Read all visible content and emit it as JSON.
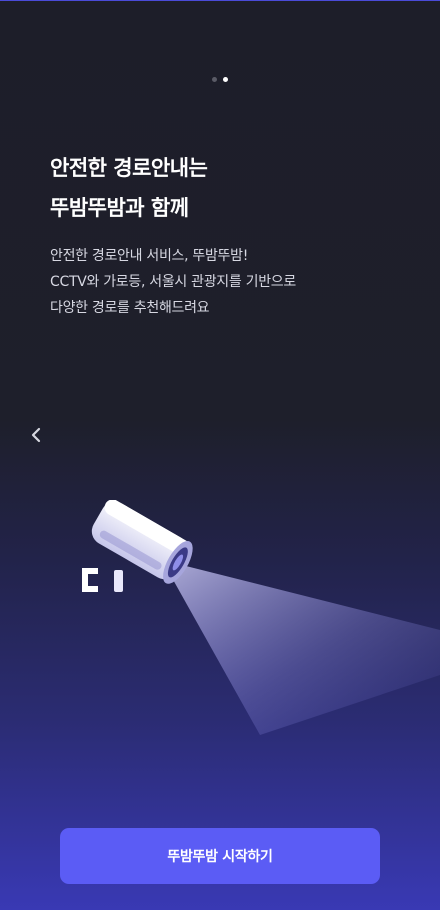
{
  "pager": {
    "total": 2,
    "active_index": 1
  },
  "headline": {
    "line1": "안전한 경로안내는",
    "line2": "뚜밤뚜밤과 함께"
  },
  "description": {
    "line1": "안전한 경로안내 서비스, 뚜밤뚜밤!",
    "line2": "CCTV와 가로등, 서울시 관광지를 기반으로",
    "line3": "다양한 경로를 추천해드려요"
  },
  "icons": {
    "back": "chevron-left-icon",
    "illustration": "cctv-camera-icon"
  },
  "cta": {
    "label": "뚜밤뚜밤 시작하기"
  },
  "colors": {
    "background_top": "#1d1e29",
    "background_bottom": "#3939b4",
    "accent": "#5b5cf5",
    "text_primary": "#ffffff",
    "text_secondary": "#d7d8e2"
  }
}
